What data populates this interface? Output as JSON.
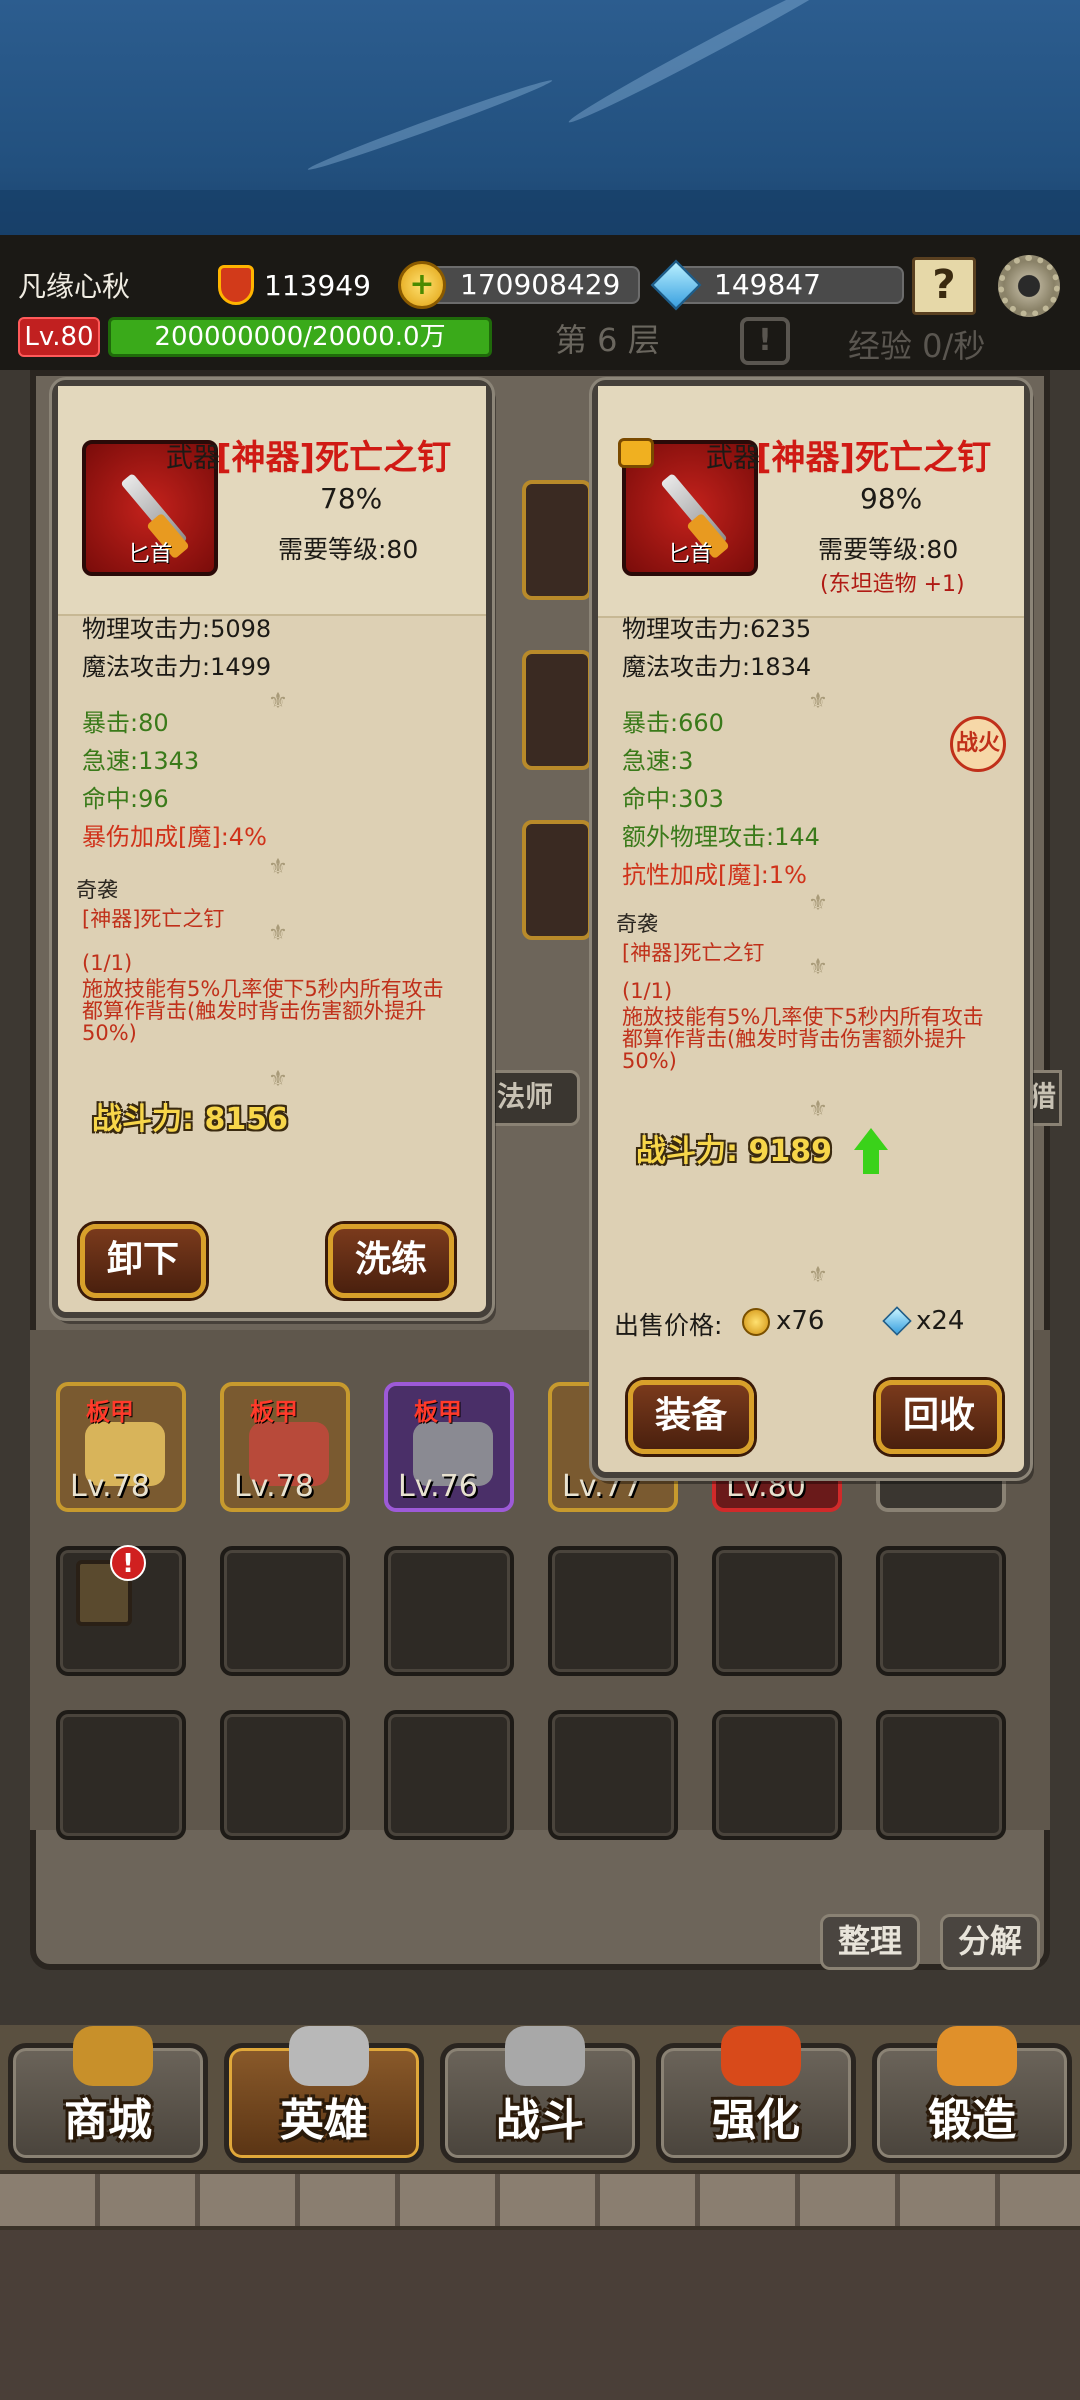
{
  "header": {
    "player_name": "凡缘心秋",
    "power_value": "113949",
    "gold": "170908429",
    "gems": "149847",
    "level": "Lv.80",
    "exp": "200000000/20000.0万",
    "floor": "第 6 层",
    "exp_rate": "经验 0/秒"
  },
  "left_card": {
    "slot_type": "武器",
    "item_name": "[神器]死亡之钉",
    "icon_label": "匕首",
    "quality": "78%",
    "required_level": "需要等级:80",
    "base_stats": [
      "物理攻击力:5098",
      "魔法攻击力:1499"
    ],
    "green_stats": [
      "暴击:80",
      "急速:1343",
      "命中:96"
    ],
    "red_stats": [
      "暴伤加成[魔]:4%"
    ],
    "set_title": "奇袭",
    "set_item": "[神器]死亡之钉",
    "set_count": "(1/1)",
    "set_effect": "施放技能有5%几率使下5秒内所有攻击都算作背击(触发时背击伤害额外提升50%)",
    "power": "战斗力: 8156",
    "buttons": {
      "unequip": "卸下",
      "reforge": "洗练"
    }
  },
  "right_card": {
    "slot_type": "武器",
    "item_name": "[神器]死亡之钉",
    "icon_label": "匕首",
    "quality": "98%",
    "required_level": "需要等级:80",
    "note": "(东坦造物 +1)",
    "base_stats": [
      "物理攻击力:6235",
      "魔法攻击力:1834"
    ],
    "green_stats": [
      "暴击:660",
      "急速:3",
      "命中:303",
      "额外物理攻击:144"
    ],
    "red_stats": [
      "抗性加成[魔]:1%"
    ],
    "seal": "战火",
    "set_title": "奇袭",
    "set_item": "[神器]死亡之钉",
    "set_count": "(1/1)",
    "set_effect": "施放技能有5%几率使下5秒内所有攻击都算作背击(触发时背击伤害额外提升50%)",
    "power": "战斗力: 9189",
    "sell_label": "出售价格:",
    "sell_gold": "x76",
    "sell_gems": "x24",
    "buttons": {
      "equip": "装备",
      "recycle": "回收"
    }
  },
  "inventory": {
    "items": [
      {
        "tag": "板甲",
        "level": "Lv.78"
      },
      {
        "tag": "板甲",
        "level": "Lv.78"
      },
      {
        "tag": "板甲",
        "level": "Lv.76"
      },
      {
        "tag": "",
        "level": "Lv.77"
      },
      {
        "tag": "",
        "level": "Lv.80"
      }
    ],
    "sort_button": "整理",
    "decompose_button": "分解",
    "bag_badge": "!"
  },
  "side_labels": {
    "mage": "法师",
    "hunter": "猎"
  },
  "nav": [
    "商城",
    "英雄",
    "战斗",
    "强化",
    "锻造"
  ],
  "colors": {
    "item_name": "#d01a14",
    "green_stat": "#3a7a1a",
    "red_stat": "#d0321a",
    "power_text": "#f7d64a",
    "exp_bar": "#3aaa1a",
    "level_badge": "#c12020"
  }
}
